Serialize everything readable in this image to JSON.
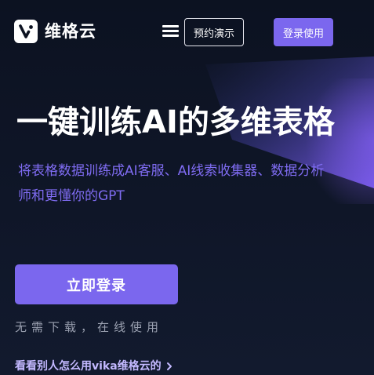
{
  "header": {
    "logo_text": "维格云",
    "logo_icon": "vika-logo-icon",
    "menu_icon": "hamburger-menu-icon",
    "demo_label": "预约演示",
    "login_label": "登录使用"
  },
  "hero": {
    "title": "一键训练AI的多维表格",
    "subtitle": "将表格数据训练成AI客服、AI线索收集器、数据分析师和更懂你的GPT",
    "cta_label": "立即登录",
    "cta_note": "无需下载，在线使用",
    "cases_link_label": "看看别人怎么用vika维格云的",
    "cases_link_icon": "chevron-right-icon"
  },
  "colors": {
    "background": "#0c1221",
    "accent": "#7b67ee",
    "subtitle": "#7f6cf2",
    "link": "#c3b9ff",
    "muted_text": "#9aa0b0"
  }
}
